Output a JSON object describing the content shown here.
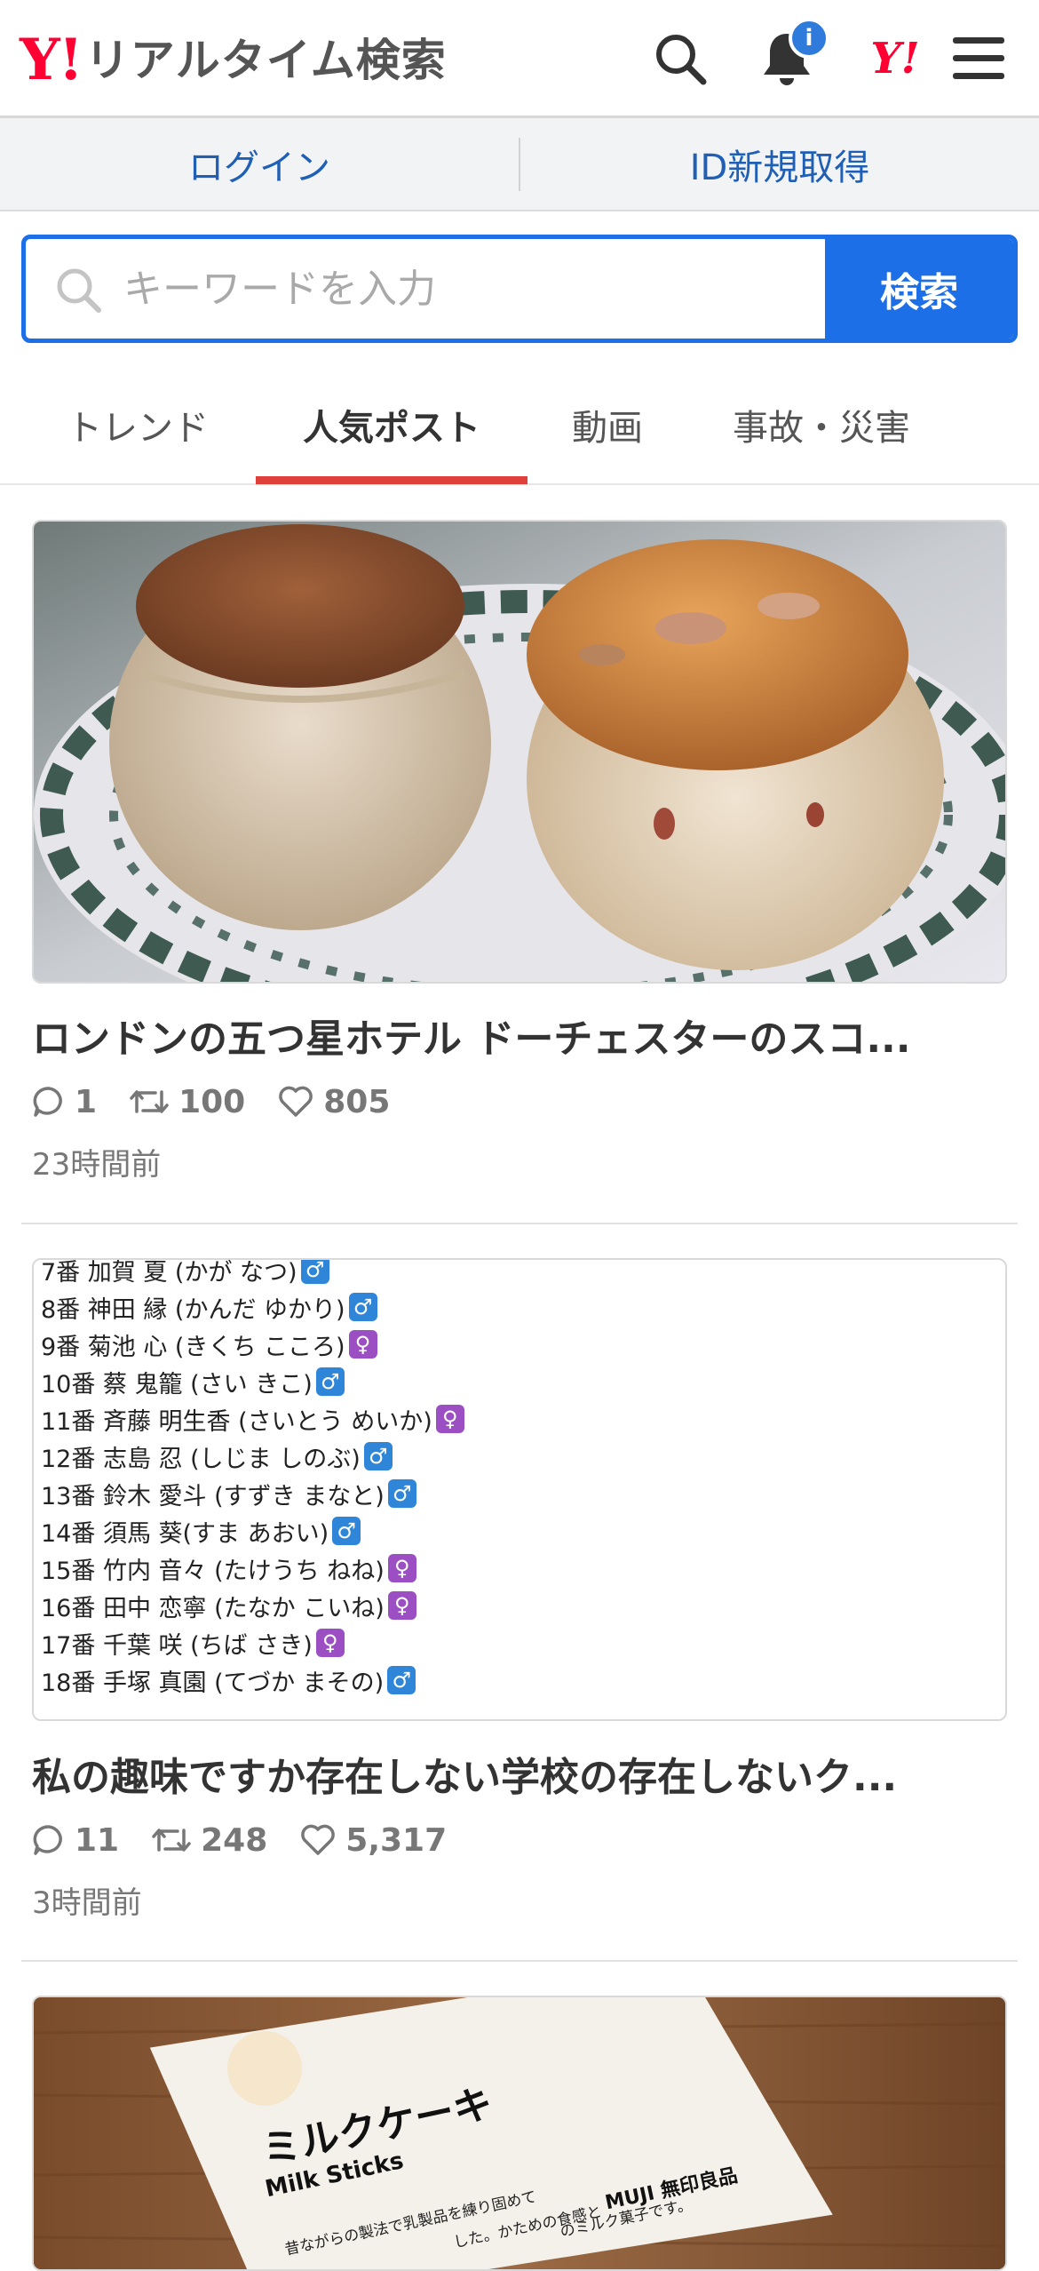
{
  "header": {
    "logo_mark": "Y!",
    "logo_text": "リアルタイム検索",
    "notification_badge": "i",
    "yahoo_mark": "Y!"
  },
  "login_bar": {
    "login_label": "ログイン",
    "signup_label": "ID新規取得"
  },
  "search": {
    "placeholder": "キーワードを入力",
    "button_label": "検索"
  },
  "tabs": [
    {
      "label": "トレンド"
    },
    {
      "label": "人気ポスト"
    },
    {
      "label": "動画"
    },
    {
      "label": "事故・災害"
    }
  ],
  "posts": [
    {
      "title": "ロンドンの五つ星ホテル ドーチェスターのスコ...",
      "replies": "1",
      "reposts": "100",
      "likes": "805",
      "time": "23時間前"
    },
    {
      "title": "私の趣味ですか󠄀存在しない学校の存在しないク...",
      "replies": "11",
      "reposts": "248",
      "likes": "5,317",
      "time": "3時間前",
      "image_lines": [
        {
          "text": "7番 加賀 夏 (かが なつ)",
          "g": "m"
        },
        {
          "text": "8番 神田 縁 (かんだ ゆかり)",
          "g": "m"
        },
        {
          "text": "9番 菊池 心 (きくち こころ)",
          "g": "f"
        },
        {
          "text": "10番 蔡 鬼籠 (さい きこ)",
          "g": "m"
        },
        {
          "text": "11番 斉藤 明生香 (さいとう めいか)",
          "g": "f"
        },
        {
          "text": "12番 志島 忍 (しじま しのぶ)",
          "g": "m"
        },
        {
          "text": "13番 鈴木 愛斗 (すずき まなと)",
          "g": "m"
        },
        {
          "text": "14番 須馬 葵(すま あおい)",
          "g": "m"
        },
        {
          "text": "15番 竹内 音々 (たけうち ねね)",
          "g": "f"
        },
        {
          "text": "16番 田中 恋寧 (たなか こいね)",
          "g": "f"
        },
        {
          "text": "17番 千葉 咲 (ちば さき)",
          "g": "f"
        },
        {
          "text": "18番 手塚 真園 (てづか まその)",
          "g": "m"
        }
      ]
    },
    {
      "image_text": {
        "product_jp": "ミルクケーキ",
        "product_en": "Milk Sticks",
        "description_line1": "昔ながらの製法で乳製品を練り固めて",
        "description_line2": "した。かための食感と",
        "description_line3": "のミルク菓子です。",
        "brand": "MUJI 無印良品"
      }
    }
  ]
}
